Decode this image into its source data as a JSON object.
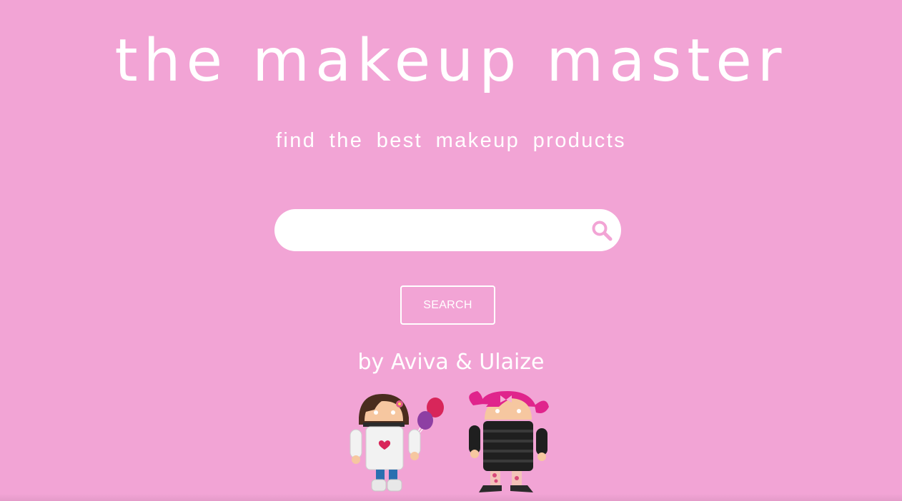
{
  "header": {
    "title": "the makeup master",
    "subtitle": "find the best makeup products"
  },
  "search": {
    "value": "",
    "placeholder": "",
    "icon": "search-icon",
    "button_label": "SEARCH"
  },
  "footer": {
    "byline": "by Aviva & Ulaize",
    "illustration": "two android girl figures with balloons"
  },
  "colors": {
    "background": "#f2a4d5",
    "text": "#ffffff",
    "accent": "#f2a4d5"
  }
}
